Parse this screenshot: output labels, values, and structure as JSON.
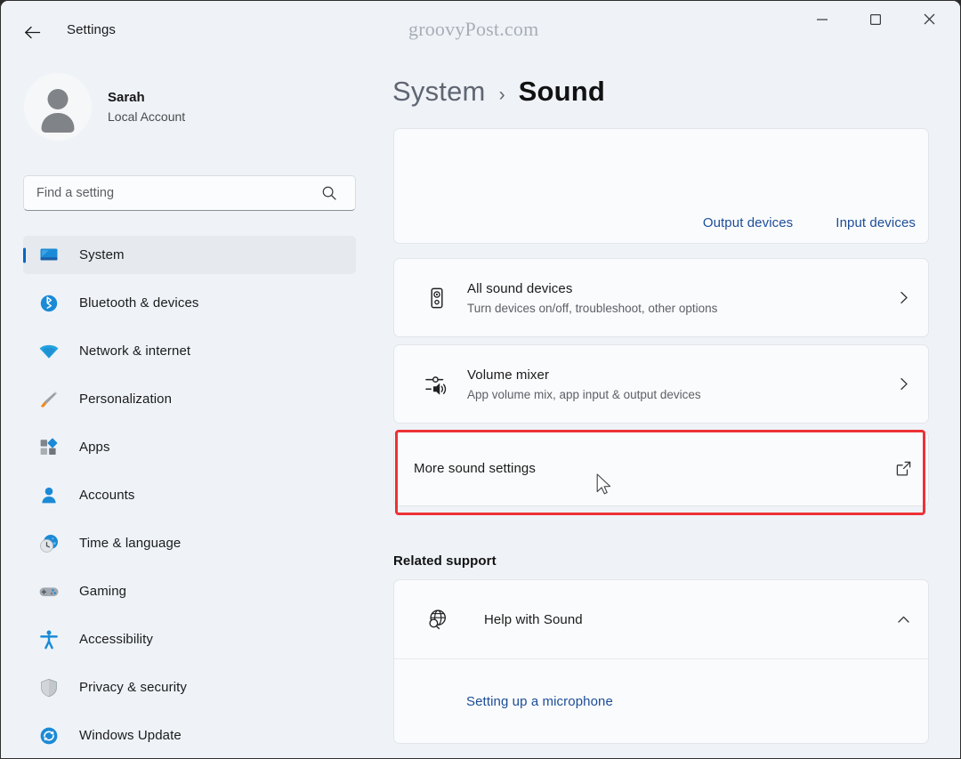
{
  "window": {
    "app_title": "Settings",
    "watermark": "groovyPost.com",
    "back_icon": "back-arrow-icon",
    "controls": {
      "minimize": "minimize-icon",
      "maximize": "maximize-icon",
      "close": "close-icon"
    }
  },
  "accent_colors": {
    "selection_bar": "#0268c4",
    "link": "#1c4d99",
    "highlight_annotation": "#ec3237",
    "window_bg": "#eff3f8",
    "card_bg": "#fafbfc",
    "card_border": "#e2e5e9",
    "nav_active_bg": "#e6eaef"
  },
  "sidebar": {
    "account": {
      "name": "Sarah",
      "type": "Local Account",
      "avatar_icon": "user-avatar-icon"
    },
    "search": {
      "placeholder": "Find a setting",
      "value": "",
      "icon": "search-icon"
    },
    "items": [
      {
        "label": "System",
        "icon": "monitor-icon",
        "active": true
      },
      {
        "label": "Bluetooth & devices",
        "icon": "bluetooth-icon",
        "active": false
      },
      {
        "label": "Network & internet",
        "icon": "wifi-icon",
        "active": false
      },
      {
        "label": "Personalization",
        "icon": "paintbrush-icon",
        "active": false
      },
      {
        "label": "Apps",
        "icon": "apps-grid-icon",
        "active": false
      },
      {
        "label": "Accounts",
        "icon": "person-icon",
        "active": false
      },
      {
        "label": "Time & language",
        "icon": "clock-globe-icon",
        "active": false
      },
      {
        "label": "Gaming",
        "icon": "gamepad-icon",
        "active": false
      },
      {
        "label": "Accessibility",
        "icon": "accessibility-icon",
        "active": false
      },
      {
        "label": "Privacy & security",
        "icon": "shield-icon",
        "active": false
      },
      {
        "label": "Windows Update",
        "icon": "refresh-icon",
        "active": false
      }
    ]
  },
  "content": {
    "breadcrumb": {
      "parent": "System",
      "separator": "›",
      "current": "Sound"
    },
    "device_links": [
      {
        "label": "Output devices"
      },
      {
        "label": "Input devices"
      }
    ],
    "settings": [
      {
        "title": "All sound devices",
        "subtitle": "Turn devices on/off, troubleshoot, other options",
        "icon": "speaker-icon",
        "action_icon": "chevron-right-icon"
      },
      {
        "title": "Volume mixer",
        "subtitle": "App volume mix, app input & output devices",
        "icon": "volume-mixer-icon",
        "action_icon": "chevron-right-icon"
      }
    ],
    "more_sound": {
      "title": "More sound settings",
      "action_icon": "external-link-icon",
      "highlighted": true
    },
    "related_support": {
      "heading": "Related support",
      "help": {
        "title": "Help with Sound",
        "icon": "globe-search-icon",
        "expand_icon": "chevron-up-icon",
        "expanded": true,
        "links": [
          {
            "label": "Setting up a microphone"
          }
        ]
      }
    }
  }
}
